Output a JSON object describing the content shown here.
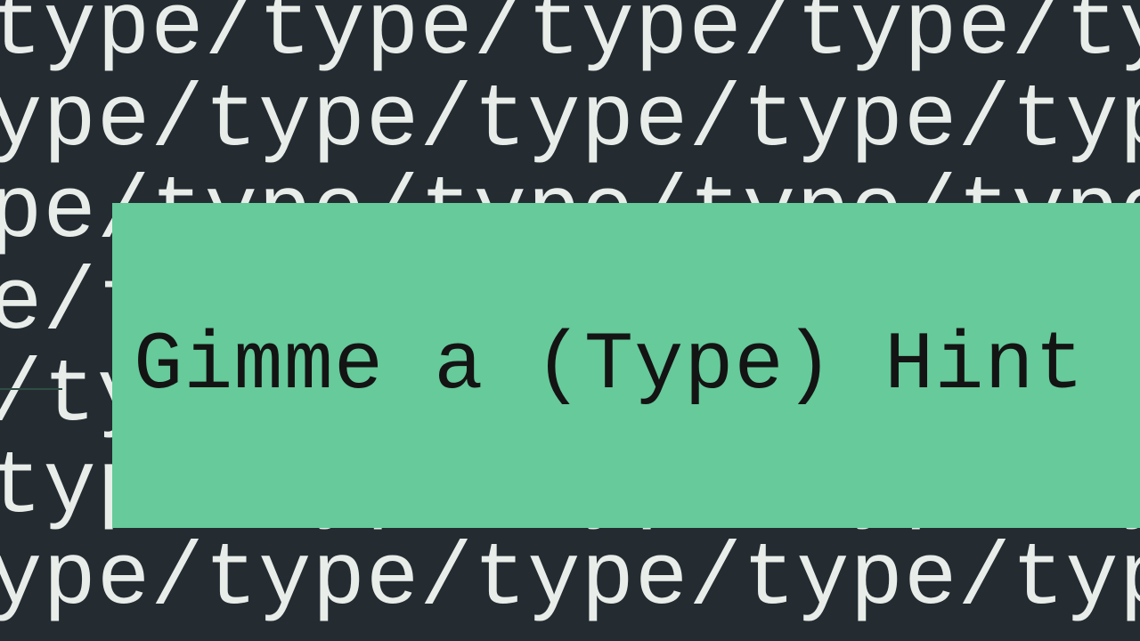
{
  "background": {
    "repeat_word": "type",
    "separator": "/",
    "line1": "type/type/type/type/type/",
    "line2": "ype/type/type/type/type/t",
    "line3": "pe/type/type/type/type/ty",
    "line4": "e/type/type/type/type/typ",
    "line5": "/type/type/type/type/type",
    "line6": "type/type/type/type/type/",
    "line7": "ype/type/type/type/type/t"
  },
  "title": {
    "text": "Gimme a (Type) Hint"
  },
  "colors": {
    "bg": "#242c32",
    "text": "#e8ede9",
    "card": "#66ca9a",
    "title_text": "#141414"
  }
}
